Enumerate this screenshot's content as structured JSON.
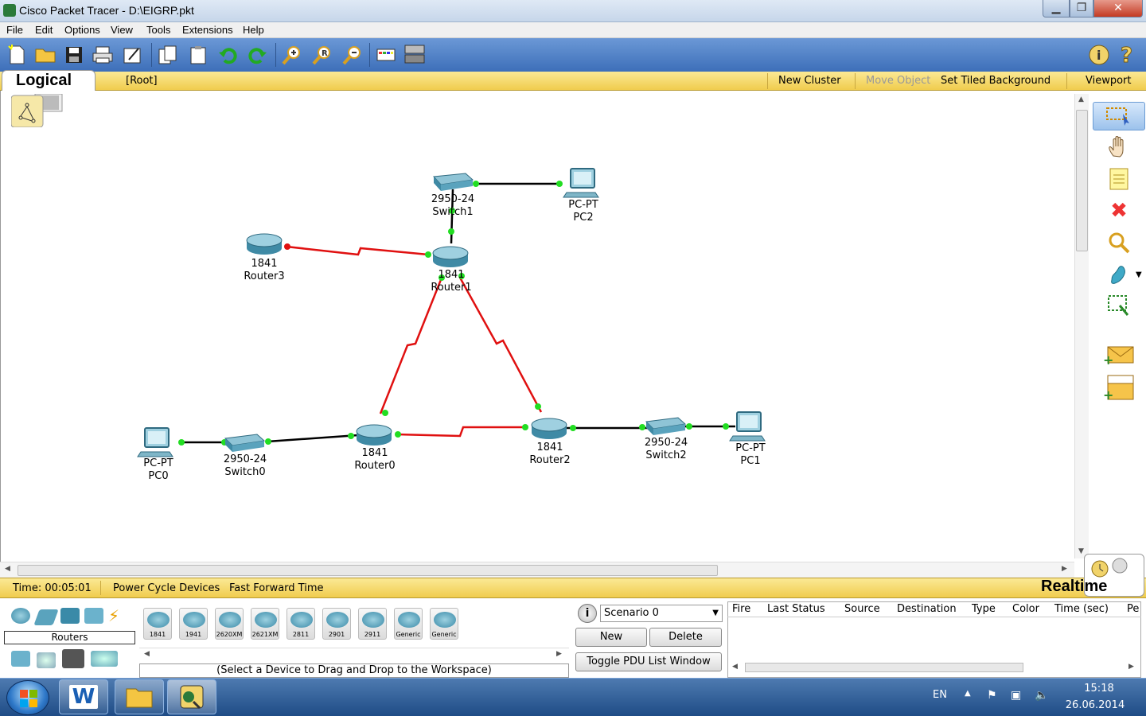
{
  "window": {
    "title": "Cisco Packet Tracer - D:\\EIGRP.pkt"
  },
  "menu": [
    "File",
    "Edit",
    "Options",
    "View",
    "Tools",
    "Extensions",
    "Help"
  ],
  "logical_bar": {
    "tab_label": "Logical",
    "root_label": "[Root]",
    "new_cluster": "New Cluster",
    "move_object": "Move Object",
    "set_tiled_background": "Set Tiled Background",
    "viewport": "Viewport"
  },
  "topology": {
    "devices": [
      {
        "model": "2950-24",
        "name": "Switch1"
      },
      {
        "model": "PC-PT",
        "name": "PC2"
      },
      {
        "model": "1841",
        "name": "Router3"
      },
      {
        "model": "1841",
        "name": "Router1"
      },
      {
        "model": "PC-PT",
        "name": "PC0"
      },
      {
        "model": "2950-24",
        "name": "Switch0"
      },
      {
        "model": "1841",
        "name": "Router0"
      },
      {
        "model": "1841",
        "name": "Router2"
      },
      {
        "model": "2950-24",
        "name": "Switch2"
      },
      {
        "model": "PC-PT",
        "name": "PC1"
      }
    ],
    "link_colors": {
      "ethernet": "#000000",
      "serial": "#e01010",
      "port_up": "#22dd22",
      "port_down": "#e01010"
    }
  },
  "statusbar": {
    "time": "Time: 00:05:01",
    "power_cycle": "Power Cycle Devices",
    "fast_forward": "Fast Forward Time",
    "mode": "Realtime"
  },
  "device_panel": {
    "category": "Routers",
    "devices": [
      "1841",
      "1941",
      "2620XM",
      "2621XM",
      "2811",
      "2901",
      "2911",
      "Generic",
      "Generic"
    ],
    "hint": "(Select a Device to Drag and Drop to the Workspace)"
  },
  "scenario": {
    "selected": "Scenario 0",
    "new_label": "New",
    "delete_label": "Delete",
    "toggle_label": "Toggle PDU List Window"
  },
  "pdu_table": {
    "columns": [
      "Fire",
      "Last Status",
      "Source",
      "Destination",
      "Type",
      "Color",
      "Time (sec)",
      "Pe"
    ]
  },
  "taskbar": {
    "apps": [
      "W"
    ],
    "language": "EN",
    "time": "15:18",
    "date": "26.06.2014"
  }
}
